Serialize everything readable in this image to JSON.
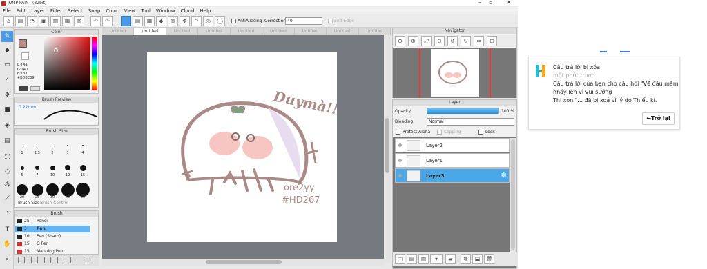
{
  "app": {
    "title": "JUMP PAINT (32bit)"
  },
  "menu": [
    "File",
    "Edit",
    "Layer",
    "Filter",
    "Select",
    "Snap",
    "Color",
    "View",
    "Tool",
    "Window",
    "Cloud",
    "Help"
  ],
  "toolbar": {
    "antialiasing": "AntiAliasing",
    "correction_label": "Correction",
    "correction_value": "40",
    "soft_edge": "Soft Edge"
  },
  "color_panel": {
    "title": "Color",
    "r": "R:189",
    "g": "G:140",
    "b": "B:137",
    "hex": "#BD8C89",
    "accent": "#BD8C89"
  },
  "brush_preview": {
    "title": "Brush Preview",
    "size": "0.22mm"
  },
  "brush_size": {
    "title": "Brush Size",
    "values": [
      "1",
      "1.5",
      "2",
      "3",
      "4",
      "5",
      "7",
      "10",
      "12",
      "15",
      "20",
      "25",
      "30",
      "40",
      "50"
    ],
    "tabs": [
      "Brush Size",
      "Brush Control"
    ]
  },
  "brush": {
    "title": "Brush",
    "items": [
      {
        "size": "25",
        "name": "Pencil",
        "color": "#222222"
      },
      {
        "size": "3",
        "name": "Pen",
        "color": "#222222"
      },
      {
        "size": "10",
        "name": "Pen (Sharp)",
        "color": "#222222"
      },
      {
        "size": "15",
        "name": "G Pen",
        "color": "#d03030"
      },
      {
        "size": "15",
        "name": "Mapping Pen",
        "color": "#d03030"
      }
    ]
  },
  "tabs": [
    "Untitled",
    "Untitled",
    "Untitled",
    "Untitled",
    "Untitled",
    "Untitled",
    "Untitled",
    "Untitled",
    "Untitled"
  ],
  "artwork": {
    "text1": "Duymà!!",
    "text2": "ore2yy",
    "text3": "#HD267"
  },
  "navigator": {
    "title": "Navigator"
  },
  "layer_panel": {
    "title": "Layer",
    "opacity_label": "Opacity",
    "opacity_value": "100 %",
    "opacity_level": 1.0,
    "blending_label": "Blending",
    "blending_value": "Normal",
    "protect_alpha": "Protect Alpha",
    "clipping": "Clipping",
    "lock": "Lock",
    "layers": [
      {
        "name": "Layer2"
      },
      {
        "name": "Layer1"
      },
      {
        "name": "Layer3"
      }
    ]
  },
  "notification": {
    "line1": "Câu trả lời bị xóa",
    "line2": "một phút trước",
    "line3": "Câu trả lời của bạn cho câu hỏi \"Vẽ đậu mầm",
    "line4": "nháy lên vì vui sướng",
    "line5": "Thi xon \"... đã bị xoá vì lý do Thiếu kí.",
    "back_button": "←Trở lại"
  }
}
